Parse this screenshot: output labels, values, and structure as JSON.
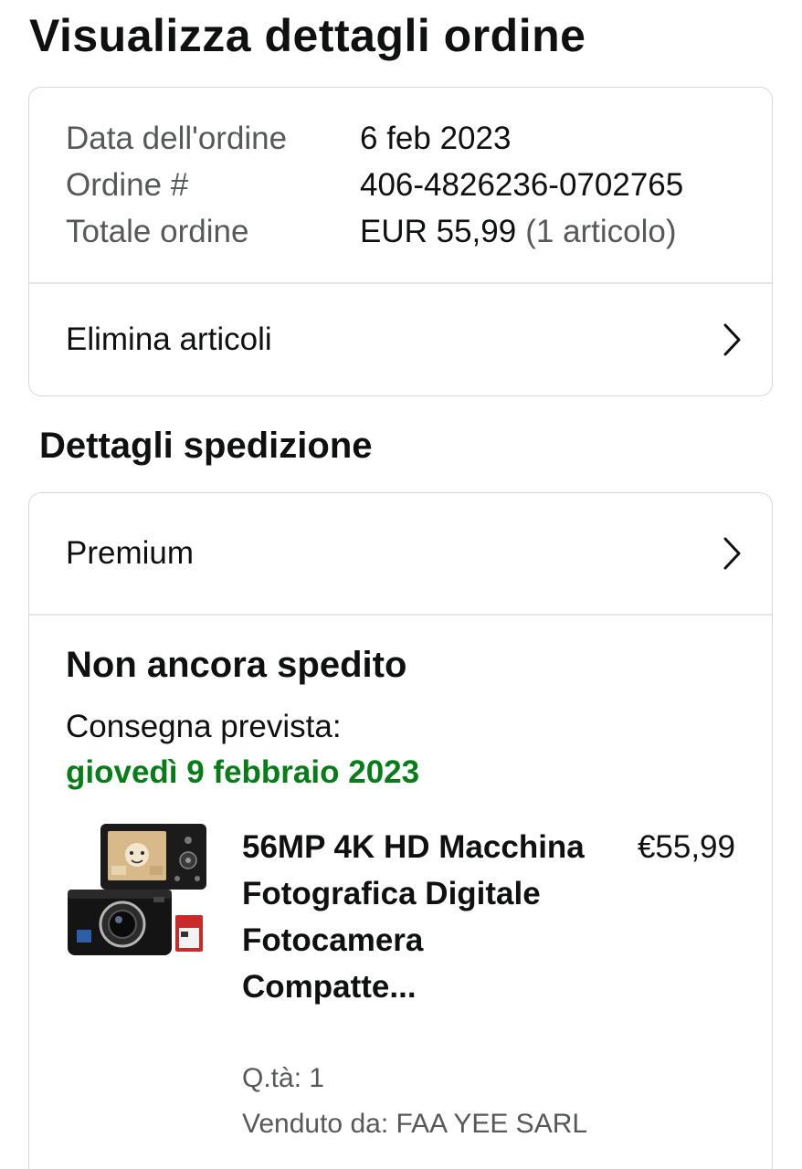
{
  "page_title": "Visualizza dettagli ordine",
  "summary": {
    "rows": [
      {
        "label": "Data dell'ordine",
        "value": "6 feb 2023"
      },
      {
        "label": "Ordine #",
        "value": "406-4826236-0702765"
      },
      {
        "label": "Totale ordine",
        "value": "EUR 55,99",
        "extra": "(1 articolo)"
      }
    ],
    "remove_items_label": "Elimina articoli"
  },
  "shipping": {
    "section_title": "Dettagli spedizione",
    "method_label": "Premium",
    "status": "Non ancora spedito",
    "delivery_label": "Consegna prevista:",
    "delivery_date": "giovedì 9 febbraio 2023",
    "delivery_date_color": "#067d16"
  },
  "product": {
    "title": "56MP 4K HD Macchina Fotografica Digitale Fotocamera Compatte...",
    "price": "€55,99",
    "quantity": "Q.tà: 1",
    "seller": "Venduto da: FAA YEE SARL",
    "image_icon": "digital-camera-product-image"
  },
  "icons": {
    "chevron": "chevron-right-icon"
  }
}
